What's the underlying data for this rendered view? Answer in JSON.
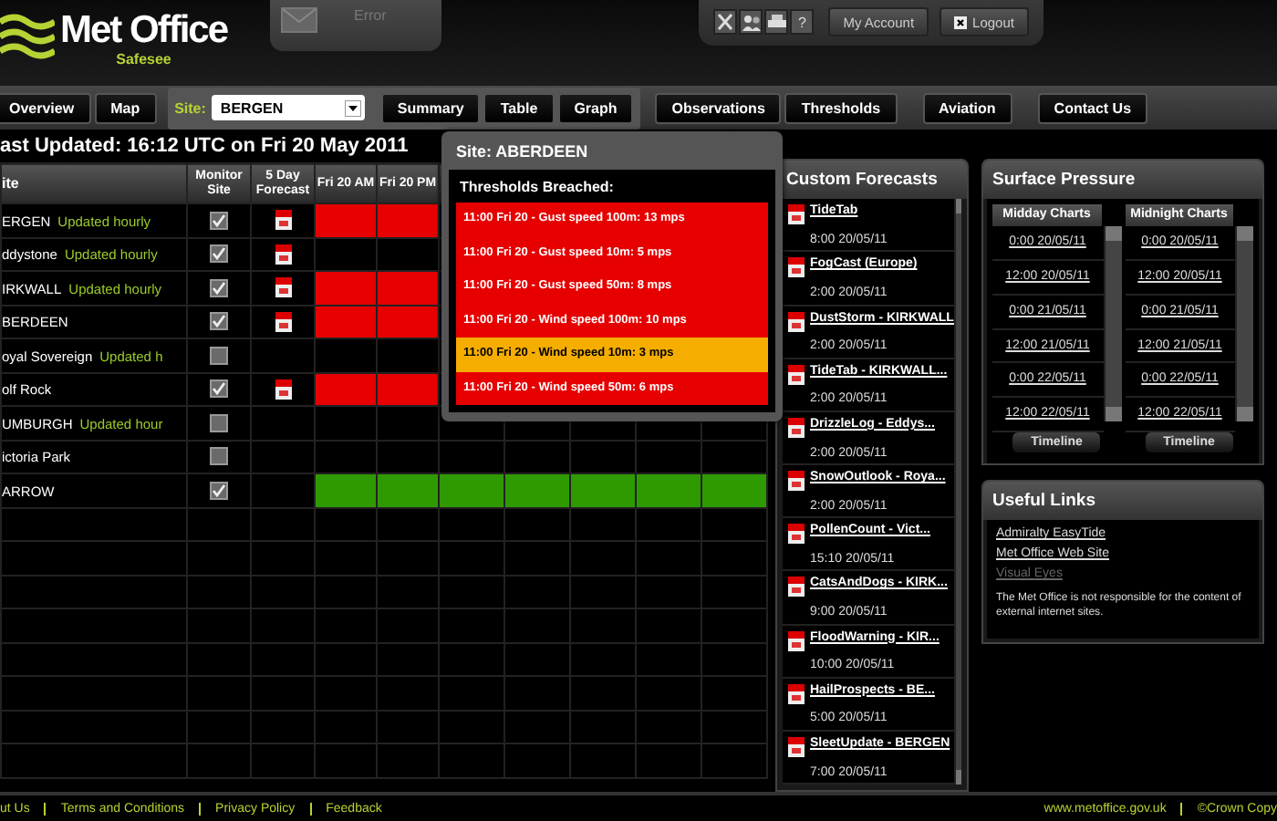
{
  "header": {
    "logo_title": "Met Office",
    "logo_subtitle": "Safesee",
    "message_tab": "Error",
    "help_label": "?",
    "account_buttons": [
      "My Account",
      "Logout"
    ]
  },
  "nav": {
    "groups": [
      {
        "kind": "buttons",
        "buttons": [
          "Overview",
          "Map"
        ]
      },
      {
        "kind": "site",
        "label": "Site:",
        "value": "BERGEN",
        "buttons": [
          "Summary",
          "Table",
          "Graph"
        ]
      },
      {
        "kind": "buttons",
        "buttons": [
          "Observations",
          "Thresholds"
        ]
      },
      {
        "kind": "buttons",
        "buttons": [
          "Aviation"
        ]
      },
      {
        "kind": "buttons",
        "buttons": [
          "Contact Us"
        ]
      }
    ]
  },
  "last_updated": "ast Updated: 16:12 UTC on Fri 20 May 2011",
  "table": {
    "columns": [
      "ite",
      "Monitor Site",
      "5 Day Forecast",
      "Fri 20 AM",
      "Fri 20 PM"
    ],
    "rows": [
      {
        "site": "ERGEN",
        "note": "Updated hourly",
        "monitored": true,
        "forecast": true,
        "cells": [
          {
            "color": "#e60000"
          },
          {
            "color": "#e60000"
          }
        ]
      },
      {
        "site": "ddystone",
        "note": "Updated hourly",
        "monitored": true,
        "forecast": true,
        "cells": [
          {
            "color": "#000000"
          },
          {
            "color": "#000000"
          }
        ]
      },
      {
        "site": "IRKWALL",
        "note": "Updated hourly",
        "monitored": true,
        "forecast": true,
        "cells": [
          {
            "color": "#e60000"
          },
          {
            "color": "#e60000"
          }
        ]
      },
      {
        "site": "BERDEEN",
        "monitored": true,
        "forecast": true,
        "cells": [
          {
            "color": "#e60000"
          },
          {
            "color": "#e60000"
          }
        ]
      },
      {
        "site": "oyal Sovereign",
        "note": "Updated h",
        "monitored": false,
        "forecast": false,
        "cells": [
          {
            "color": "#000000"
          },
          {
            "color": "#000000"
          }
        ]
      },
      {
        "site": "olf Rock",
        "monitored": true,
        "forecast": true,
        "cells": [
          {
            "color": "#e60000"
          },
          {
            "color": "#e60000"
          }
        ]
      },
      {
        "site": "UMBURGH",
        "note": "Updated hour",
        "monitored": false,
        "forecast": false,
        "cells": [
          {
            "color": "#000000"
          },
          {
            "color": "#000000"
          },
          {
            "color": "#000000"
          },
          {
            "color": "#000000"
          },
          {
            "color": "#000000"
          },
          {
            "color": "#000000"
          },
          {
            "color": "#000000"
          }
        ]
      },
      {
        "site": "ictoria Park",
        "monitored": false,
        "forecast": false,
        "cells": [
          {
            "color": "#000000"
          },
          {
            "color": "#000000"
          },
          {
            "color": "#000000"
          },
          {
            "color": "#000000"
          },
          {
            "color": "#000000"
          },
          {
            "color": "#000000"
          },
          {
            "color": "#000000"
          }
        ]
      },
      {
        "site": "ARROW",
        "monitored": true,
        "forecast": false,
        "cells": [
          {
            "color": "#2f9a00"
          },
          {
            "color": "#2f9a00"
          },
          {
            "color": "#2f9a00"
          },
          {
            "color": "#2f9a00"
          },
          {
            "color": "#2f9a00"
          },
          {
            "color": "#2f9a00"
          },
          {
            "color": "#2f9a00"
          }
        ]
      }
    ]
  },
  "popup": {
    "title": "Site: ABERDEEN",
    "heading": "Thresholds Breached:",
    "items": [
      {
        "text": "11:00 Fri 20 - Gust speed 100m: 13 mps",
        "color": "#e60000"
      },
      {
        "text": "11:00 Fri 20 - Gust speed 10m: 5 mps",
        "color": "#e60000"
      },
      {
        "text": "11:00 Fri 20 - Gust speed 50m: 8 mps",
        "color": "#e60000"
      },
      {
        "text": "11:00 Fri 20 - Wind speed 100m: 10 mps",
        "color": "#e60000"
      },
      {
        "text": "11:00 Fri 20 - Wind speed 10m: 3 mps",
        "color": "#f5ad00"
      },
      {
        "text": "11:00 Fri 20 - Wind speed 50m: 6 mps",
        "color": "#e60000"
      }
    ]
  },
  "custom_forecasts": {
    "title": "Custom Forecasts",
    "items": [
      {
        "name": "TideTab",
        "time": "8:00 20/05/11"
      },
      {
        "name": "FogCast (Europe)",
        "time": "2:00 20/05/11"
      },
      {
        "name": "DustStorm - KIRKWALL",
        "time": "2:00 20/05/11"
      },
      {
        "name": "TideTab - KIRKWALL...",
        "time": "2:00 20/05/11"
      },
      {
        "name": "DrizzleLog - Eddys...",
        "time": "2:00 20/05/11"
      },
      {
        "name": "SnowOutlook - Roya...",
        "time": "2:00 20/05/11"
      },
      {
        "name": "PollenCount - Vict...",
        "time": "15:10 20/05/11"
      },
      {
        "name": "CatsAndDogs - KIRK...",
        "time": "9:00 20/05/11"
      },
      {
        "name": "FloodWarning - KIR...",
        "time": "10:00 20/05/11"
      },
      {
        "name": "HailProspects - BE...",
        "time": "5:00 20/05/11"
      },
      {
        "name": "SleetUpdate - BERGEN",
        "time": "7:00 20/05/11"
      }
    ]
  },
  "surface_pressure": {
    "title": "Surface Pressure",
    "columns": [
      {
        "title": "Midday Charts",
        "links": [
          "0:00 20/05/11",
          "12:00 20/05/11",
          "0:00 21/05/11",
          "12:00 21/05/11",
          "0:00 22/05/11",
          "12:00 22/05/11"
        ],
        "button": "Timeline"
      },
      {
        "title": "Midnight Charts",
        "links": [
          "0:00 20/05/11",
          "12:00 20/05/11",
          "0:00 21/05/11",
          "12:00 21/05/11",
          "0:00 22/05/11",
          "12:00 22/05/11"
        ],
        "button": "Timeline"
      }
    ]
  },
  "useful_links": {
    "title": "Useful Links",
    "links": [
      {
        "text": "Admiralty EasyTide",
        "disabled": false
      },
      {
        "text": "Met Office Web Site",
        "disabled": false
      },
      {
        "text": "Visual Eyes",
        "disabled": true
      }
    ],
    "note": "The Met Office is not responsible for the content of external internet sites."
  },
  "footer": {
    "left_links": [
      "ut Us",
      "Terms and Conditions",
      "Privacy Policy",
      "Feedback"
    ],
    "right_items": [
      "www.metoffice.gov.uk",
      "©Crown Copy"
    ]
  }
}
